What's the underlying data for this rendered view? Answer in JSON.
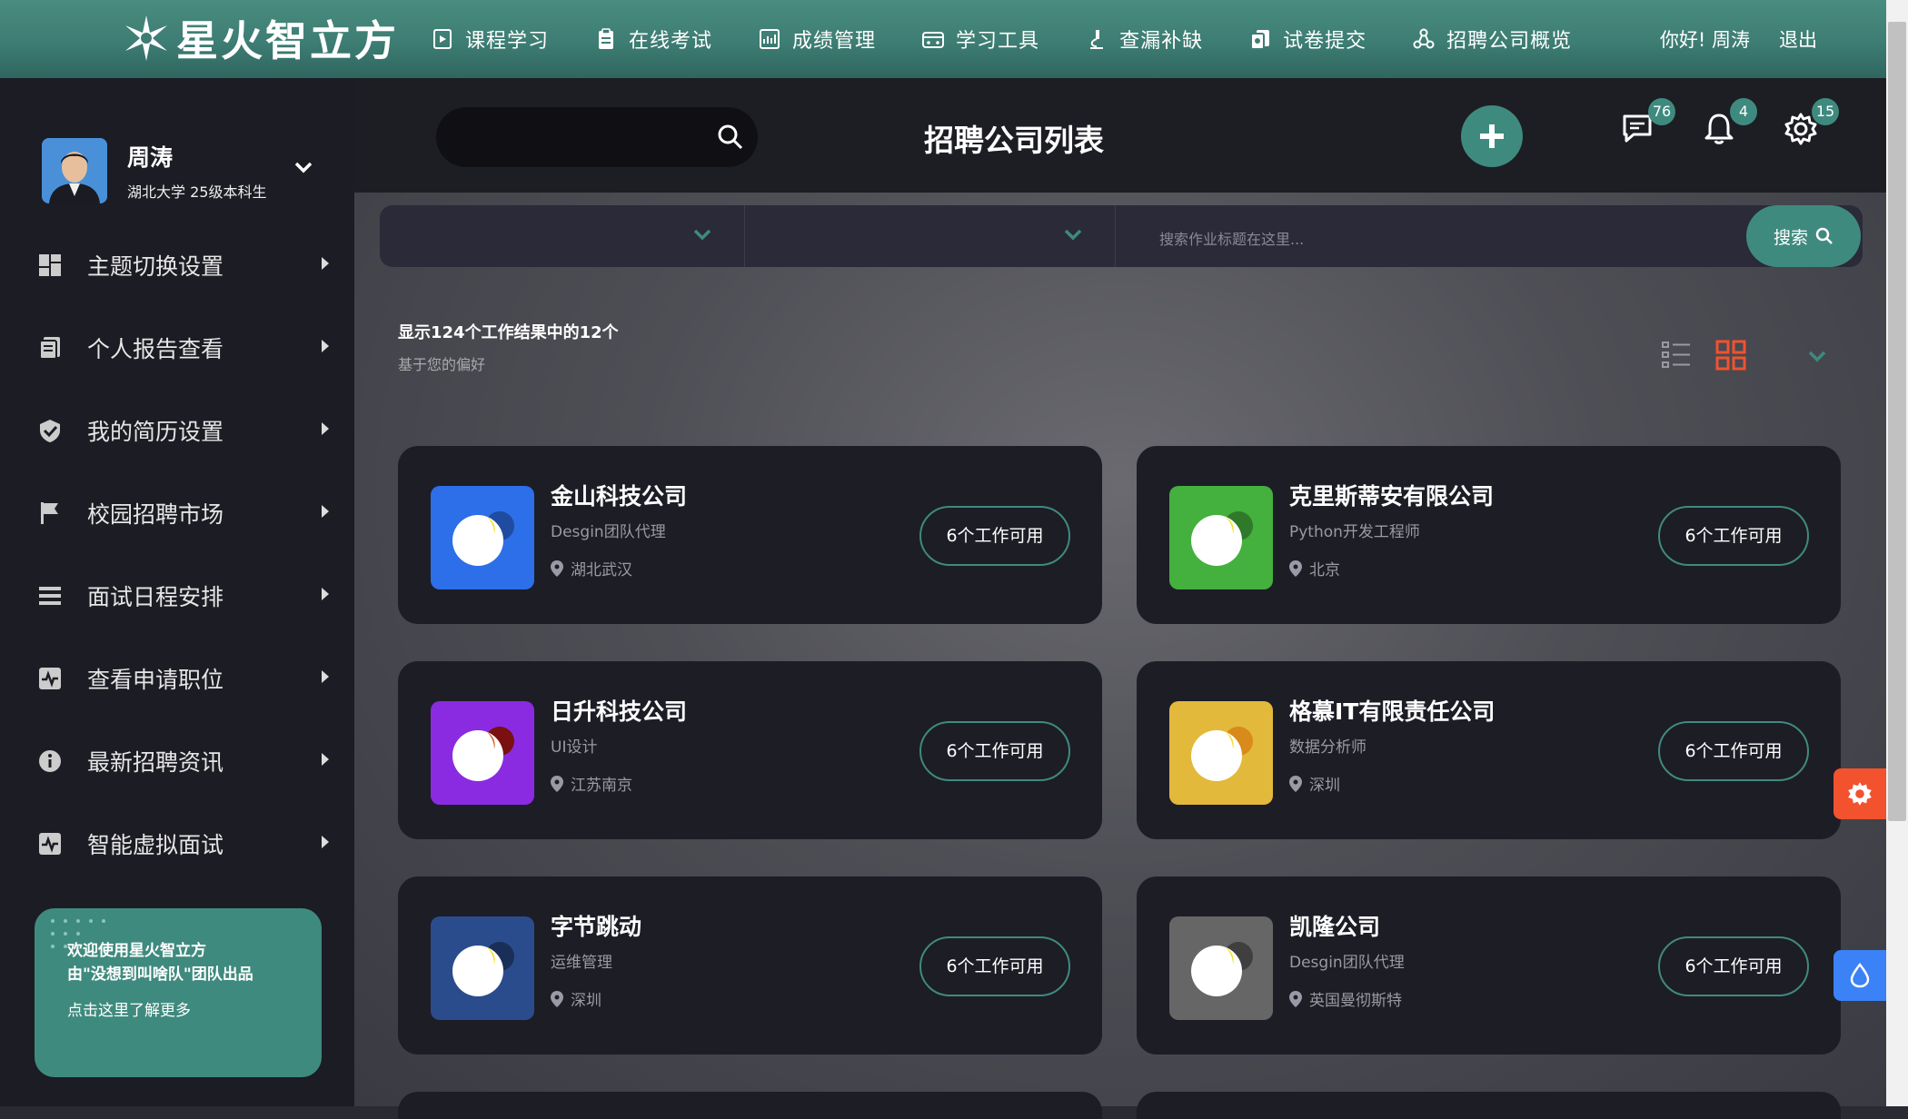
{
  "app": {
    "logo_text": "星火智立方"
  },
  "nav": [
    {
      "label": "课程学习",
      "icon": "play-doc-icon"
    },
    {
      "label": "在线考试",
      "icon": "clipboard-icon"
    },
    {
      "label": "成绩管理",
      "icon": "chart-icon"
    },
    {
      "label": "学习工具",
      "icon": "wallet-icon"
    },
    {
      "label": "查漏补缺",
      "icon": "microscope-icon"
    },
    {
      "label": "试卷提交",
      "icon": "docs-icon"
    },
    {
      "label": "招聘公司概览",
      "icon": "network-icon"
    }
  ],
  "user": {
    "greeting": "你好! 周涛",
    "logout": "退出",
    "name": "周涛",
    "subtitle": "湖北大学 25级本科生"
  },
  "sidebar": {
    "items": [
      {
        "label": "主题切换设置",
        "icon": "dashboard-icon"
      },
      {
        "label": "个人报告查看",
        "icon": "report-icon"
      },
      {
        "label": "我的简历设置",
        "icon": "shield-check-icon"
      },
      {
        "label": "校园招聘市场",
        "icon": "flag-icon"
      },
      {
        "label": "面试日程安排",
        "icon": "list-icon"
      },
      {
        "label": "查看申请职位",
        "icon": "pulse-icon"
      },
      {
        "label": "最新招聘资讯",
        "icon": "info-icon"
      },
      {
        "label": "智能虚拟面试",
        "icon": "pulse-icon"
      }
    ],
    "promo": {
      "line1": "欢迎使用星火智立方",
      "line2": "由\"没想到叫啥队\"团队出品",
      "line3": "点击这里了解更多"
    }
  },
  "header": {
    "title": "招聘公司列表",
    "badges": {
      "messages": "76",
      "notifications": "4",
      "settings": "15"
    }
  },
  "filter": {
    "placeholder": "搜索作业标题在这里...",
    "search_label": "搜索"
  },
  "results": {
    "count_text": "显示124个工作结果中的12个",
    "sub_text": "基于您的偏好"
  },
  "colors": {
    "accent": "#3f8a7e",
    "orange": "#f2522e",
    "blue": "#3b82f6"
  },
  "companies": [
    {
      "name": "金山科技公司",
      "role": "Desgin团队代理",
      "location": "湖北武汉",
      "jobs": "6个工作可用",
      "color": "#2c6fe8",
      "dot": "#1f4ca0"
    },
    {
      "name": "克里斯蒂安有限公司",
      "role": "Python开发工程师",
      "location": "北京",
      "jobs": "6个工作可用",
      "color": "#44b03e",
      "dot": "#2f7a2a"
    },
    {
      "name": "日升科技公司",
      "role": "UI设计",
      "location": "江苏南京",
      "jobs": "6个工作可用",
      "color": "#8a2be2",
      "dot": "#5a1a96"
    },
    {
      "name": "格慕IT有限责任公司",
      "role": "数据分析师",
      "location": "深圳",
      "jobs": "6个工作可用",
      "color": "#e3b93c",
      "dot": "#b88a10"
    },
    {
      "name": "字节跳动",
      "role": "运维管理",
      "location": "深圳",
      "jobs": "6个工作可用",
      "color": "#2b4c8c",
      "dot": "#1a2f58"
    },
    {
      "name": "凯隆公司",
      "role": "Desgin团队代理",
      "location": "英国曼彻斯特",
      "jobs": "6个工作可用",
      "color": "#666666",
      "dot": "#3f3f3f"
    }
  ]
}
